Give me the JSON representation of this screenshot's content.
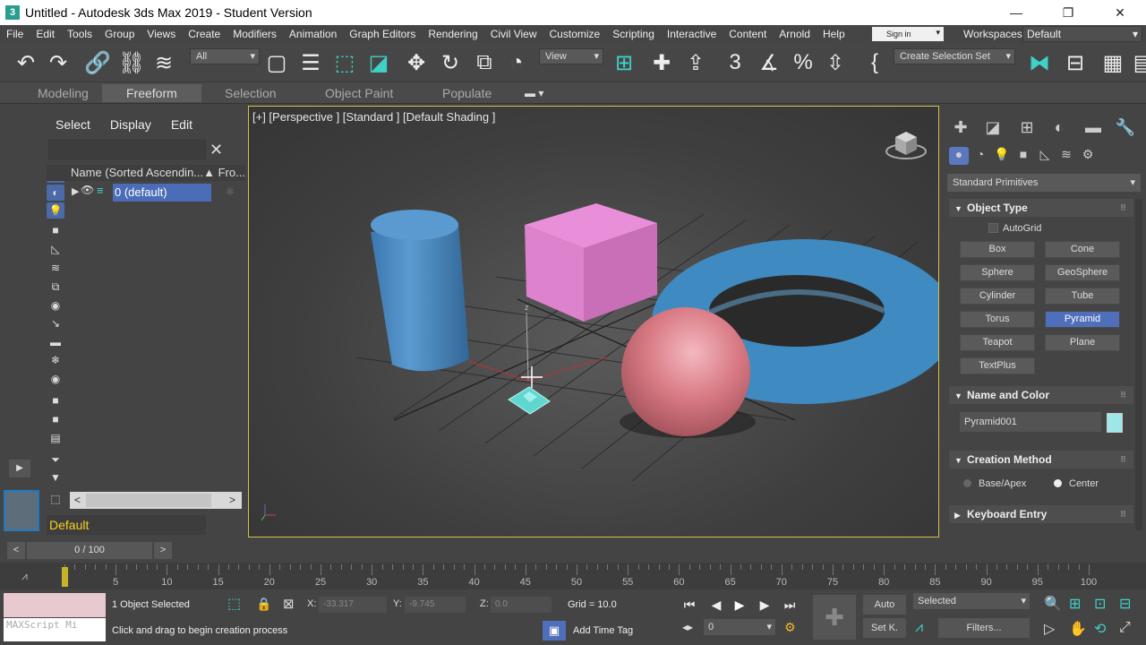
{
  "window": {
    "title": "Untitled - Autodesk 3ds Max 2019 - Student Version",
    "app_icon": "3",
    "minimize": "—",
    "restore": "❐",
    "close": "✕"
  },
  "menu": [
    "File",
    "Edit",
    "Tools",
    "Group",
    "Views",
    "Create",
    "Modifiers",
    "Animation",
    "Graph Editors",
    "Rendering",
    "Civil View",
    "Customize",
    "Scripting",
    "Interactive",
    "Content",
    "Arnold",
    "Help"
  ],
  "signin": "Sign in",
  "workspaces": {
    "label": "Workspaces:",
    "value": "Default"
  },
  "toolbar": {
    "filter_select": "All",
    "ref_coord": "View",
    "selection_set": "Create Selection Set"
  },
  "ribbon": {
    "tabs": [
      "Modeling",
      "Freeform",
      "Selection",
      "Object Paint",
      "Populate"
    ],
    "active": "Freeform"
  },
  "explorer": {
    "menus": [
      "Select",
      "Display",
      "Edit"
    ],
    "column_header": "Name (Sorted Ascendin...▲ Fro...",
    "row_label": "0 (default)",
    "layer": "Default"
  },
  "viewport": {
    "label": "[+] [Perspective ] [Standard ] [Default Shading ]",
    "axis_z": "z"
  },
  "command_panel": {
    "category": "Standard Primitives",
    "object_type": {
      "title": "Object Type",
      "autogrid": "AutoGrid",
      "buttons": [
        "Box",
        "Cone",
        "Sphere",
        "GeoSphere",
        "Cylinder",
        "Tube",
        "Torus",
        "Pyramid",
        "Teapot",
        "Plane",
        "TextPlus"
      ],
      "active": "Pyramid"
    },
    "name_color": {
      "title": "Name and Color",
      "name": "Pyramid001",
      "color": "#9fe6e8"
    },
    "creation_method": {
      "title": "Creation Method",
      "options": [
        "Base/Apex",
        "Center"
      ],
      "selected": "Center"
    },
    "keyboard_entry": {
      "title": "Keyboard Entry"
    }
  },
  "timeline": {
    "frame": "0 / 100",
    "ticks": [
      "0",
      "5",
      "10",
      "15",
      "20",
      "25",
      "30",
      "35",
      "40",
      "45",
      "50",
      "55",
      "60",
      "65",
      "70",
      "75",
      "80",
      "85",
      "90",
      "95",
      "100"
    ]
  },
  "status": {
    "maxscript": "MAXScript Mi",
    "selected": "1 Object Selected",
    "prompt": "Click and drag to begin creation process",
    "x_label": "X:",
    "x": "-33.317",
    "y_label": "Y:",
    "y": "-9.745",
    "z_label": "Z:",
    "z": "0.0",
    "grid": "Grid = 10.0",
    "add_time_tag": "Add Time Tag",
    "auto": "Auto",
    "setk": "Set K.",
    "key_filter": "Selected",
    "filters": "Filters...",
    "frame_spinner": "0"
  }
}
